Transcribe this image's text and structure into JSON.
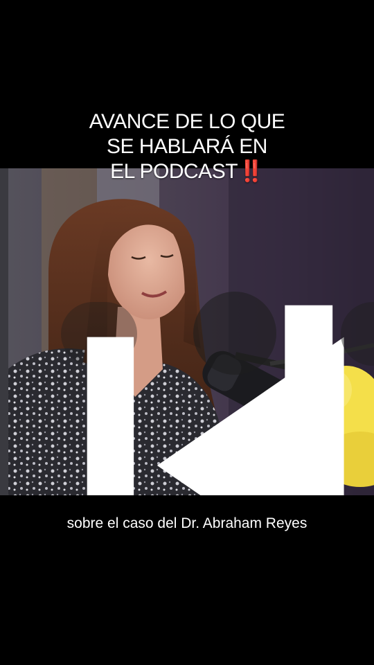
{
  "overlay": {
    "title_line1": "AVANCE DE LO QUE",
    "title_line2": "SE HABLARÁ EN",
    "title_line3": "EL PODCAST",
    "title_emoji": "‼️"
  },
  "player": {
    "prev_icon": "skip-previous-icon",
    "pause_icon": "pause-icon",
    "next_icon": "play-next-icon"
  },
  "caption": {
    "text": "sobre el caso del Dr. Abraham Reyes"
  },
  "colors": {
    "background": "#000000",
    "text": "#ffffff",
    "emoji_red": "#ff1f2d"
  }
}
